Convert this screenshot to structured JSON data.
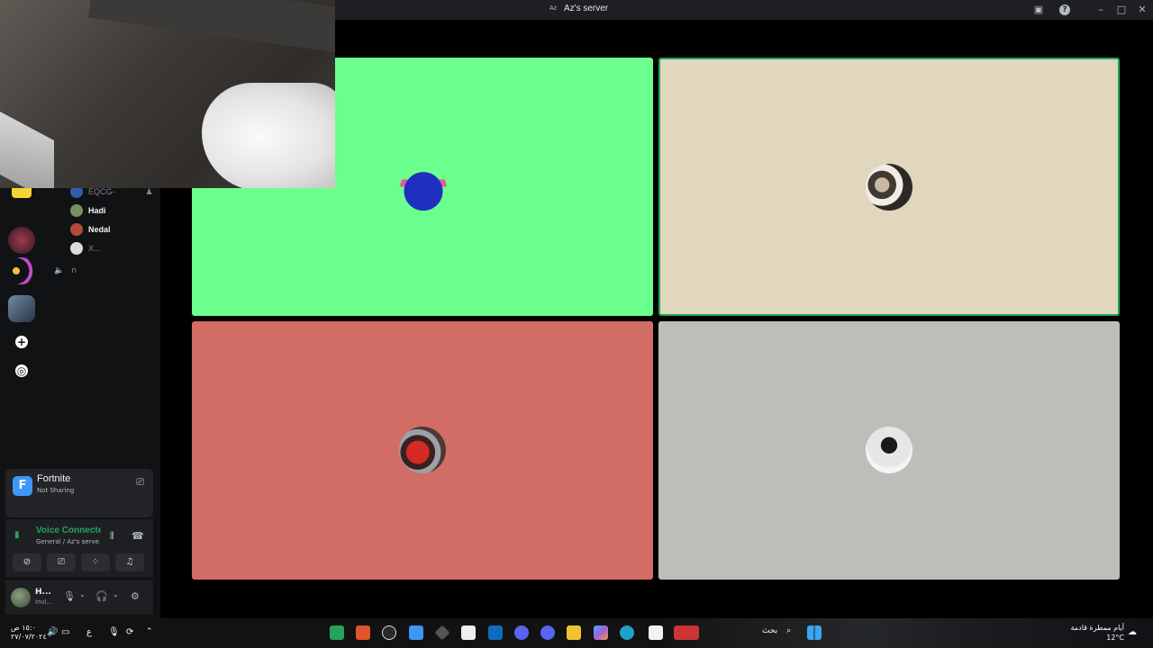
{
  "window": {
    "title": "Az's server"
  },
  "members": [
    {
      "name": "EQCG-",
      "color": "#2f5fa8",
      "dim": true
    },
    {
      "name": "Hadi",
      "color": "#7a8f64",
      "dim": false
    },
    {
      "name": "Nedal",
      "color": "#b34a3a",
      "dim": false
    },
    {
      "name": "X...",
      "color": "#dcdcdc",
      "dim": true
    }
  ],
  "channel": {
    "name": "n"
  },
  "activity": {
    "game_name": "Fortnite",
    "game_icon": "F",
    "status": "Not Sharing"
  },
  "voice": {
    "status": "Voice Connected",
    "location": "General / Az's server"
  },
  "user": {
    "name": "H...",
    "status": "Invi..."
  },
  "tiles": [
    {
      "bg": "#6bff8e",
      "avatar": "blue-bird-house-avatar"
    },
    {
      "bg": "#e1d6be",
      "avatar": "couple-photo-avatar"
    },
    {
      "bg": "#d16d64",
      "avatar": "footballer-avatar"
    },
    {
      "bg": "#bbbeb9",
      "avatar": "girl-photo-avatar"
    }
  ],
  "taskbar": {
    "time": "١٥:٠ ص",
    "date": "٢٧/٠٧/٢٠٢٤",
    "lang": "ع",
    "search_label": "بحث",
    "weather_text": "أيام ممطرة قادمة",
    "temperature": "12°C"
  }
}
